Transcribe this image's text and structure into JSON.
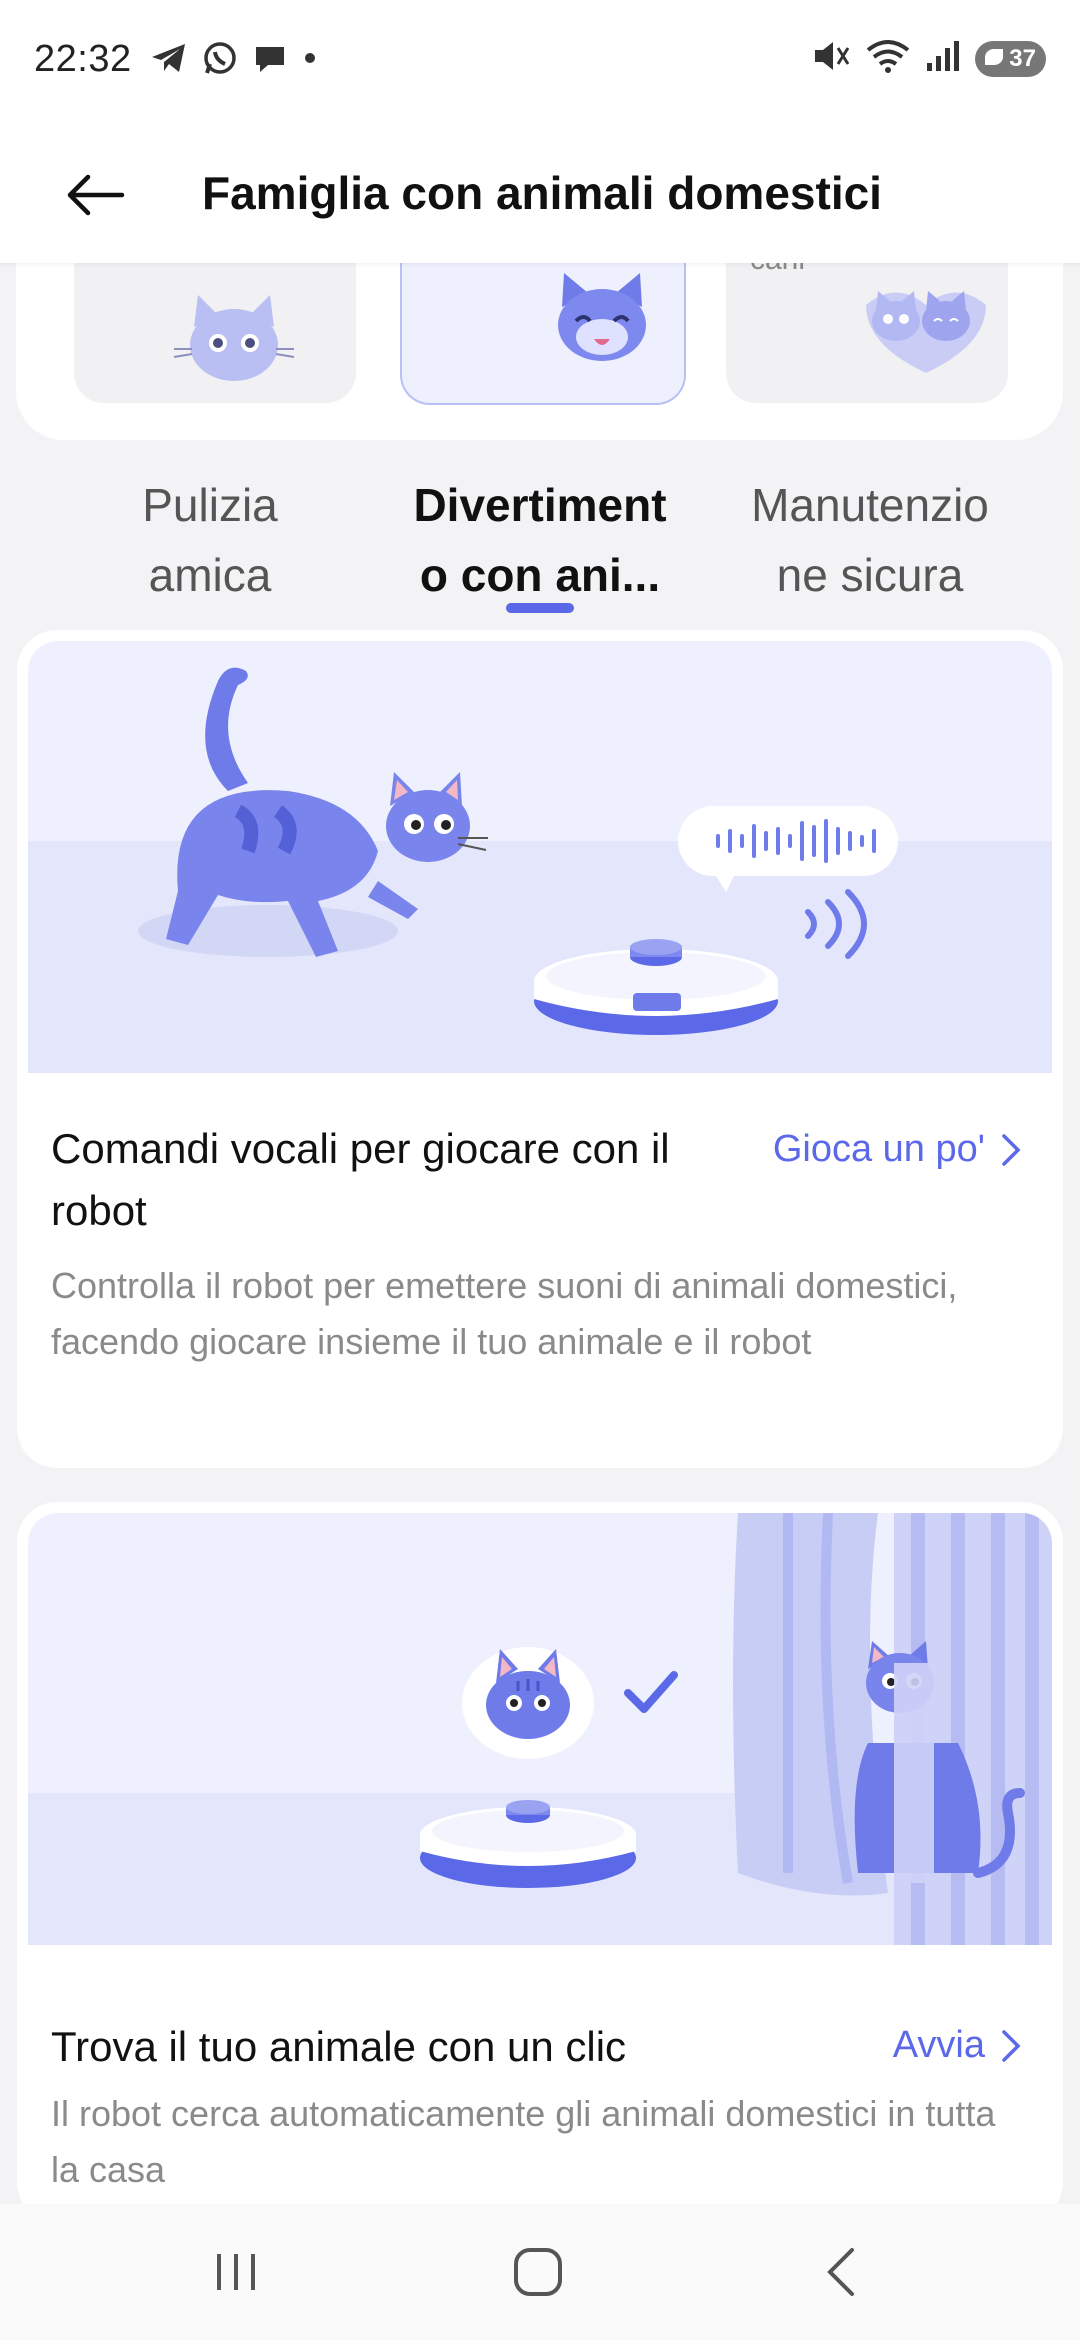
{
  "status_bar": {
    "time": "22:32",
    "left_icons": [
      "telegram-icon",
      "whatsapp-icon",
      "chat-bubble-icon",
      "dot-icon"
    ],
    "right_icons": [
      "mute-icon",
      "wifi-icon",
      "signal-icon"
    ],
    "battery": "37"
  },
  "header": {
    "title": "Famiglia con animali domestici",
    "back_icon": "arrow-left-icon"
  },
  "scenario_cards": [
    {
      "name": "scenario-card-1",
      "selected": false
    },
    {
      "name": "scenario-card-2",
      "selected": true
    },
    {
      "name": "scenario-card-3",
      "selected": false,
      "label_fragment": "cani"
    }
  ],
  "tabs": [
    {
      "label_line1": "Pulizia",
      "label_line2": "amica",
      "active": false
    },
    {
      "label_line1": "Divertiment",
      "label_line2": "o con ani...",
      "active": true
    },
    {
      "label_line1": "Manutenzio",
      "label_line2": "ne sicura",
      "active": false
    }
  ],
  "features": [
    {
      "title": "Comandi vocali per giocare con il robot",
      "title_line1": "Comandi vocali per giocare con il",
      "title_line2": "robot",
      "action": "Gioca un po'",
      "description": "Controlla il robot per emettere suoni di animali domestici, facendo giocare insieme il tuo animale e il robot"
    },
    {
      "title": "Trova il tuo animale con un clic",
      "action": "Avvia",
      "description": "Il robot cerca automaticamente gli animali domestici in tutta la casa"
    }
  ],
  "colors": {
    "accent": "#5b69e8",
    "illustration_bg": "#eef0fd",
    "cat": "#6f7be8"
  },
  "nav_bar": [
    "recents-icon",
    "home-icon",
    "back-icon"
  ]
}
